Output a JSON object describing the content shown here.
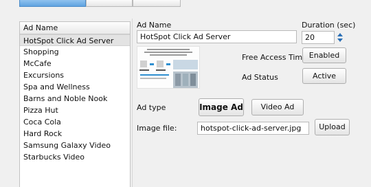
{
  "list": {
    "header": "Ad Name",
    "items": [
      "HotSpot Click Ad Server",
      "Shopping",
      "McCafe",
      "Excursions",
      "Spa and Wellness",
      "Barns and Noble Nook",
      "Pizza Hut",
      "Coca Cola",
      "Hard Rock",
      "Samsung Galaxy Video",
      "Starbucks Video"
    ],
    "selected_index": 0
  },
  "form": {
    "ad_name_label": "Ad Name",
    "ad_name_value": "HotSpot Click Ad Server",
    "duration_label": "Duration (sec)",
    "duration_value": "20",
    "free_access_label": "Free Access Timer",
    "free_access_button": "Enabled",
    "ad_status_label": "Ad Status",
    "ad_status_button": "Active",
    "ad_type_label": "Ad type",
    "image_ad_button": "Image Ad",
    "video_ad_button": "Video Ad",
    "image_file_label": "Image file:",
    "image_file_value": "hotspot-click-ad-server.jpg",
    "upload_button": "Upload"
  },
  "icons": {
    "spinner_up": "chevron-up-icon",
    "spinner_down": "chevron-down-icon"
  },
  "colors": {
    "active_tab": "#6aaae4",
    "thumbnail_accent": "#2f8fd0"
  }
}
